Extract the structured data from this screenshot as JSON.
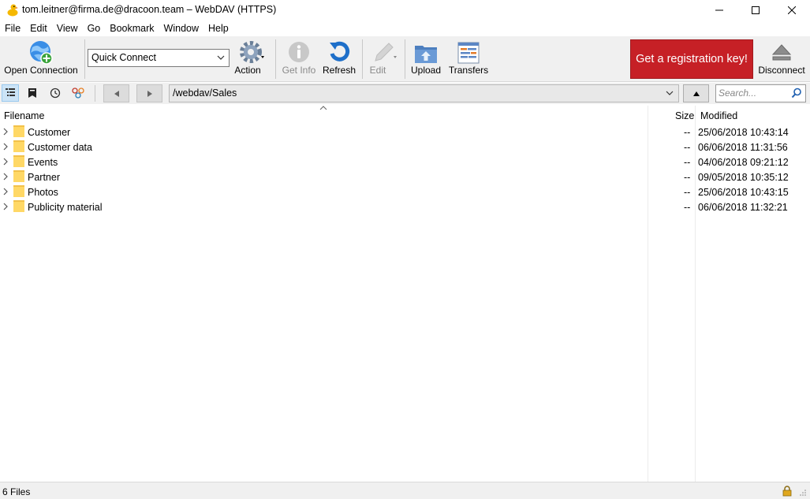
{
  "window": {
    "title": "tom.leitner@firma.de@dracoon.team – WebDAV (HTTPS)",
    "controls": [
      "minimize",
      "maximize",
      "close"
    ]
  },
  "menu": [
    "File",
    "Edit",
    "View",
    "Go",
    "Bookmark",
    "Window",
    "Help"
  ],
  "toolbar": {
    "open_connection": "Open Connection",
    "quick_connect": "Quick Connect",
    "action": "Action",
    "get_info": "Get Info",
    "refresh": "Refresh",
    "edit": "Edit",
    "upload": "Upload",
    "transfers": "Transfers",
    "registration": "Get a registration key!",
    "disconnect": "Disconnect",
    "icons": [
      "globe-plus-icon",
      "gear-icon",
      "info-icon",
      "refresh-icon",
      "pencil-icon",
      "upload-folder-icon",
      "transfers-icon",
      "eject-icon"
    ],
    "disabled": [
      "get_info",
      "edit"
    ]
  },
  "navigation": {
    "path": "/webdav/Sales",
    "search_placeholder": "Search...",
    "view_icons": [
      "browser-view-icon",
      "bookmarks-icon",
      "history-icon",
      "bonjour-icon"
    ],
    "active_view": "browser"
  },
  "columns": {
    "filename": "Filename",
    "size": "Size",
    "modified": "Modified"
  },
  "files": [
    {
      "name": "Customer",
      "size": "--",
      "modified": "25/06/2018 10:43:14"
    },
    {
      "name": "Customer data",
      "size": "--",
      "modified": "06/06/2018 11:31:56"
    },
    {
      "name": "Events",
      "size": "--",
      "modified": "04/06/2018 09:21:12"
    },
    {
      "name": "Partner",
      "size": "--",
      "modified": "09/05/2018 10:35:12"
    },
    {
      "name": "Photos",
      "size": "--",
      "modified": "25/06/2018 10:43:15"
    },
    {
      "name": "Publicity material",
      "size": "--",
      "modified": "06/06/2018 11:32:21"
    }
  ],
  "status": {
    "text": "6 Files"
  },
  "colors": {
    "registration_bg": "#c62026",
    "toolbar_bg": "#f0f0f0",
    "folder": "#ffd866",
    "accent_blue": "#1e6fc9"
  }
}
